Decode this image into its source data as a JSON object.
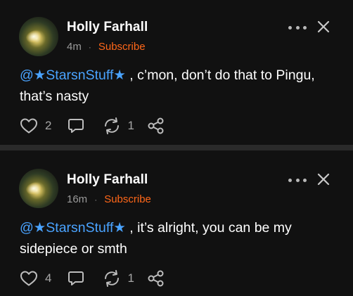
{
  "comments": [
    {
      "author": "Holly Farhall",
      "time": "4m",
      "separator": "·",
      "subscribe_label": "Subscribe",
      "mention": "@★StarsnStuff★",
      "text": " , c’mon, don’t do that to Pingu, that’s nasty",
      "likes": "2",
      "restacks": "1",
      "icons": {
        "like": "heart-icon",
        "comment": "comment-bubble-icon",
        "restack": "restack-icon",
        "share": "share-icon",
        "more": "more-dots-icon",
        "close": "close-icon"
      }
    },
    {
      "author": "Holly Farhall",
      "time": "16m",
      "separator": "·",
      "subscribe_label": "Subscribe",
      "mention": "@★StarsnStuff★",
      "text": " , it’s alright, you can be my sidepiece or smth",
      "likes": "4",
      "restacks": "1",
      "icons": {
        "like": "heart-icon",
        "comment": "comment-bubble-icon",
        "restack": "restack-icon",
        "share": "share-icon",
        "more": "more-dots-icon",
        "close": "close-icon"
      }
    }
  ],
  "colors": {
    "background": "#111111",
    "mention": "#4aa3ff",
    "subscribe": "#ff6719",
    "divider": "#2a2a2a"
  }
}
